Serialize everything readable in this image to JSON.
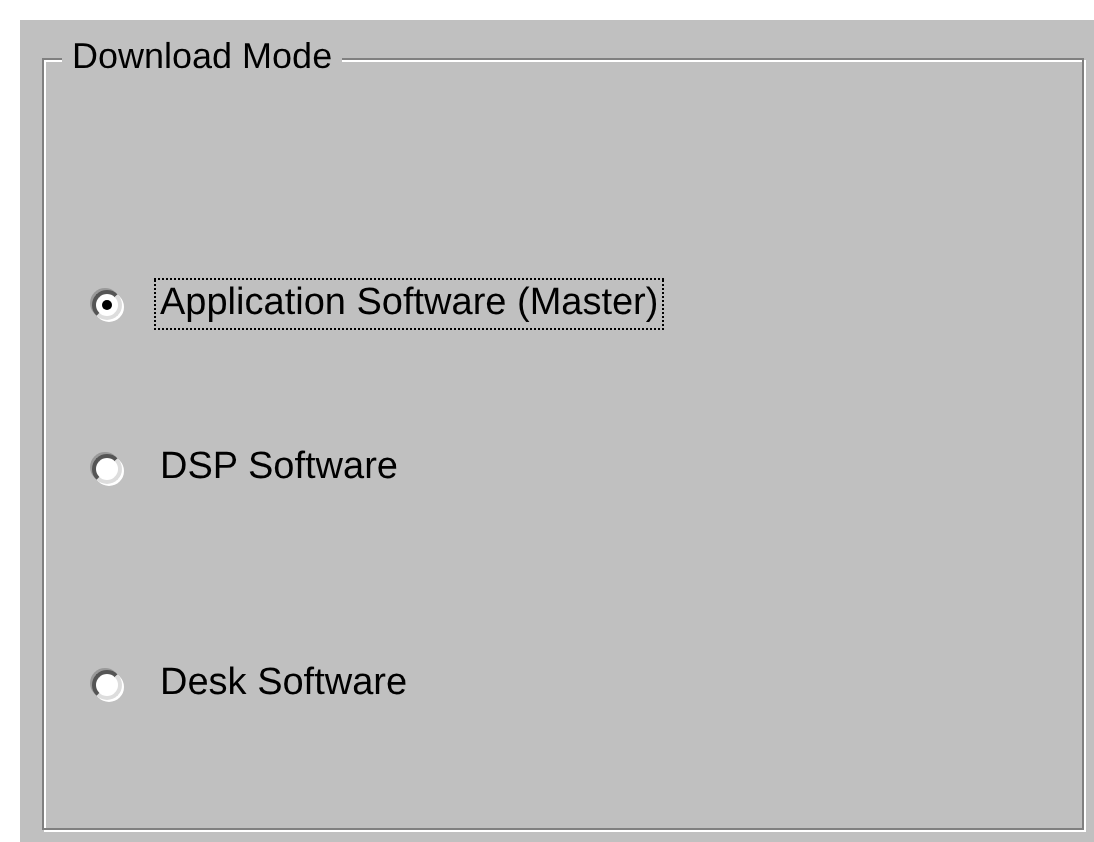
{
  "group": {
    "title": "Download Mode"
  },
  "options": [
    {
      "label": "Application Software (Master)",
      "selected": true,
      "focused": true
    },
    {
      "label": "DSP Software",
      "selected": false,
      "focused": false
    },
    {
      "label": "Desk Software",
      "selected": false,
      "focused": false
    }
  ]
}
